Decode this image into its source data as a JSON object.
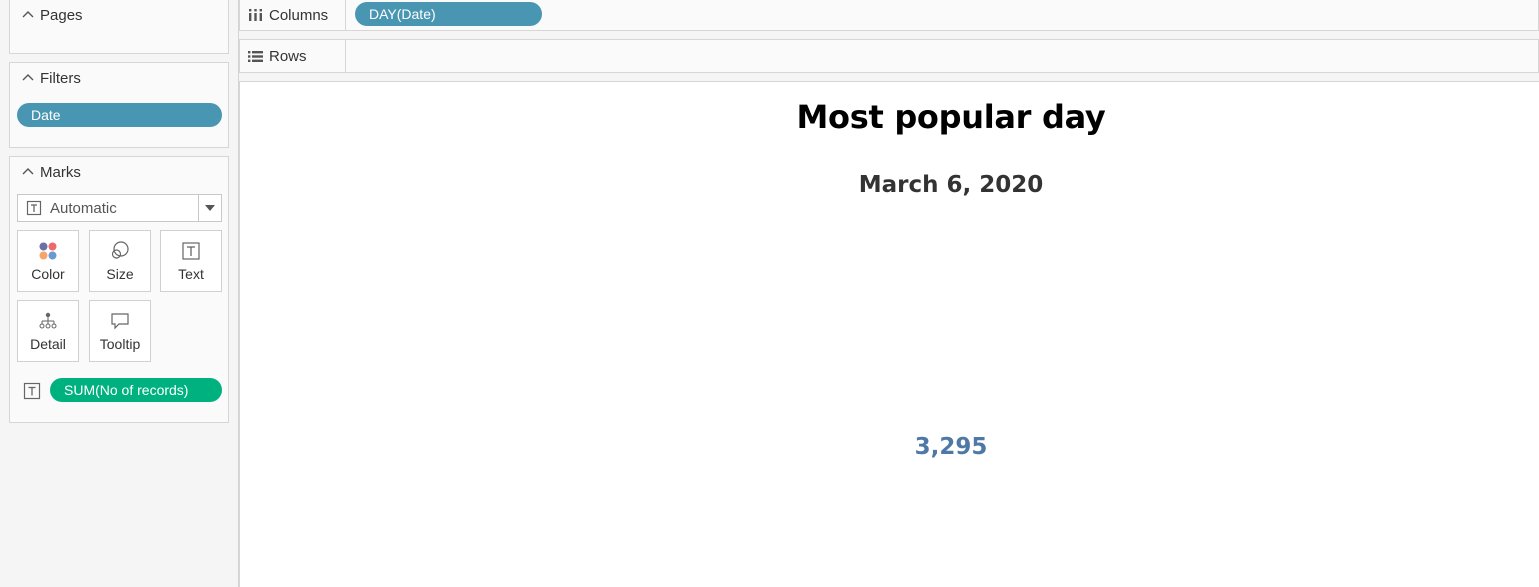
{
  "cards": {
    "pages": {
      "title": "Pages"
    },
    "filters": {
      "title": "Filters",
      "pills": [
        "Date"
      ]
    },
    "marks": {
      "title": "Marks",
      "mark_type": "Automatic",
      "buttons": {
        "color": "Color",
        "size": "Size",
        "text": "Text",
        "detail": "Detail",
        "tooltip": "Tooltip"
      },
      "text_field": "SUM(No of records)"
    }
  },
  "shelves": {
    "columns": {
      "label": "Columns",
      "pill": "DAY(Date)"
    },
    "rows": {
      "label": "Rows"
    }
  },
  "viz": {
    "title": "Most popular day",
    "subtitle": "March 6, 2020",
    "value": "3,295"
  },
  "colors": {
    "dimension_pill": "#4996b2",
    "measure_pill": "#00b180",
    "value_text": "#4e79a7"
  },
  "icons": [
    "chevron-up-icon",
    "columns-icon",
    "rows-icon",
    "text-mark-icon",
    "dropdown-arrow-icon",
    "color-icon",
    "size-icon",
    "detail-icon",
    "tooltip-icon"
  ]
}
